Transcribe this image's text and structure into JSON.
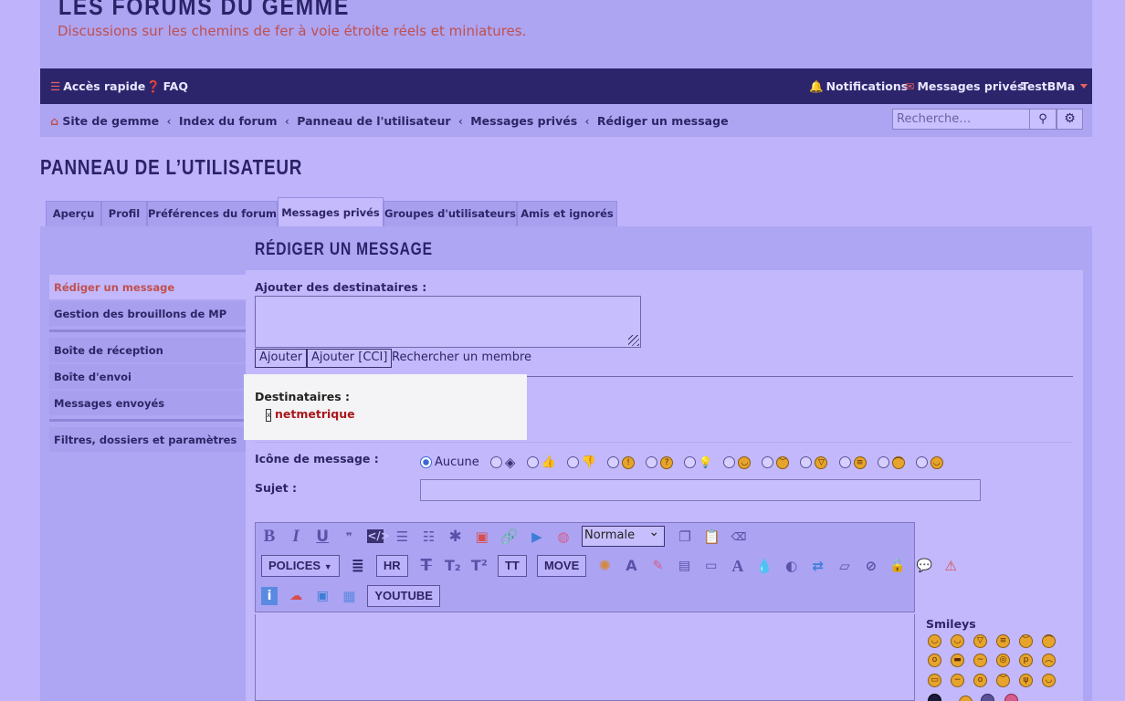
{
  "header": {
    "site_title": "LES FORUMS DU GEMME",
    "site_description": "Discussions sur les chemins de fer à voie étroite réels et miniatures."
  },
  "navbar": {
    "quick_access": "Accès rapide",
    "faq": "FAQ",
    "notifications": "Notifications",
    "private_messages": "Messages privés",
    "username": "TestBMa"
  },
  "breadcrumbs": {
    "items": [
      "Site de gemme",
      "Index du forum",
      "Panneau de l'utilisateur",
      "Messages privés",
      "Rédiger un message"
    ]
  },
  "search": {
    "placeholder": "Recherche…"
  },
  "page_title": "PANNEAU DE L’UTILISATEUR",
  "tabs": [
    "Aperçu",
    "Profil",
    "Préférences du forum",
    "Messages privés",
    "Groupes d'utilisateurs",
    "Amis et ignorés"
  ],
  "active_tab": "Messages privés",
  "sidebar": {
    "group1": [
      "Rédiger un message",
      "Gestion des brouillons de MP"
    ],
    "group2": [
      "Boîte de réception",
      "Boîte d'envoi",
      "Messages envoyés"
    ],
    "group3": [
      "Filtres, dossiers et paramètres"
    ]
  },
  "compose": {
    "title": "RÉDIGER UN MESSAGE",
    "add_recipients_label": "Ajouter des destinataires :",
    "add_button": "Ajouter",
    "add_bcc_button": "Ajouter [CCI]",
    "find_member": "Rechercher un membre",
    "recipients_label": "Destinataires :",
    "recipient_remove": "x",
    "recipient_name": "netmetrique",
    "icon_label": "Icône de message :",
    "icon_none": "Aucune",
    "subject_label": "Sujet :"
  },
  "toolbar": {
    "font_size_value": "Normale",
    "polices": "POLICES",
    "hr": "HR",
    "tt": "TT",
    "move": "MOVE",
    "youtube": "YOUTUBE"
  },
  "smileys": {
    "label": "Smileys"
  },
  "colors": {
    "accent_red": "#c0504f",
    "navbar_bg": "#2d256c",
    "recipient_red": "#a8171c"
  }
}
